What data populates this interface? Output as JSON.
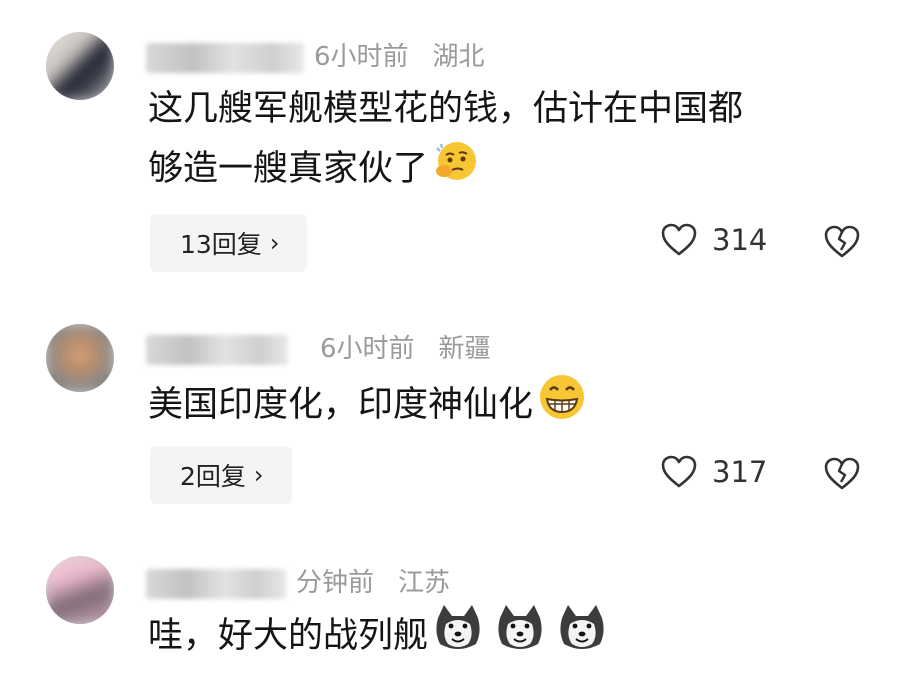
{
  "comments": [
    {
      "time": "6小时前",
      "location": "湖北",
      "text_lines": [
        "这几艘军舰模型花的钱，估计在中国都",
        "够造一艘真家伙了"
      ],
      "emoji": "thinking-face-emoji",
      "reply_label": "13回复",
      "likes": "314"
    },
    {
      "time": "6小时前",
      "location": "新疆",
      "text_lines": [
        "美国印度化，印度神仙化"
      ],
      "emoji": "grinning-face-emoji",
      "reply_label": "2回复",
      "likes": "317"
    },
    {
      "time": "分钟前",
      "location": "江苏",
      "text_lines": [
        "哇，好大的战列舰"
      ],
      "emoji": "husky-dog-emoji"
    }
  ],
  "icons": {
    "like": "heart-outline-icon",
    "dislike": "broken-heart-icon",
    "reply_chevron": "chevron-right-icon"
  },
  "colors": {
    "meta_text": "#9a9a9a",
    "body_text": "#151515",
    "reply_bg": "#f4f4f4"
  }
}
